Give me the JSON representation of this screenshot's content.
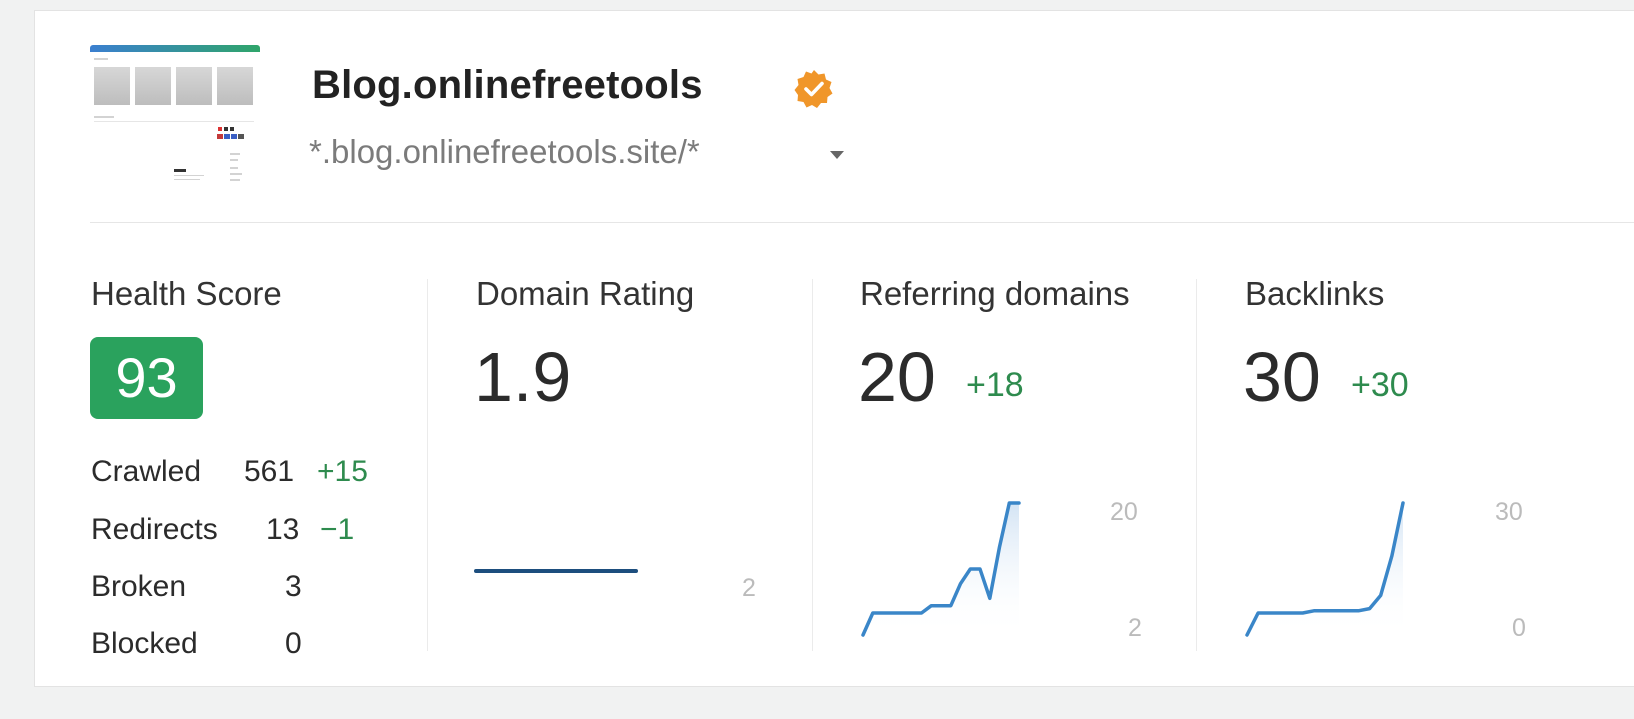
{
  "site": {
    "title": "Blog.onlinefreetools",
    "url": "*.blog.onlinefreetools.site/*",
    "verified_icon": "verified-badge-icon",
    "url_dropdown_icon": "caret-down-icon"
  },
  "colors": {
    "accent_green": "#2aa25d",
    "delta_green": "#2e8b4e",
    "spark_blue": "#3a86c8",
    "dr_line": "#1d4e7e",
    "badge_orange": "#f0962a"
  },
  "health": {
    "label": "Health Score",
    "score": "93",
    "stats": [
      {
        "label": "Crawled",
        "value": "561",
        "delta": "+15"
      },
      {
        "label": "Redirects",
        "value": "13",
        "delta": "−1"
      },
      {
        "label": "Broken",
        "value": "3",
        "delta": ""
      },
      {
        "label": "Blocked",
        "value": "0",
        "delta": ""
      }
    ]
  },
  "domain_rating": {
    "label": "Domain Rating",
    "value": "1.9",
    "axis_max": "2",
    "chart_data": {
      "type": "line",
      "values": [
        2,
        2,
        2,
        2,
        2,
        2
      ],
      "ylim": [
        0,
        4
      ]
    }
  },
  "referring_domains": {
    "label": "Referring domains",
    "value": "20",
    "delta": "+18",
    "axis_max": "20",
    "axis_min": "2",
    "chart_data": {
      "type": "area",
      "values": [
        2,
        5,
        5,
        5,
        5,
        5,
        5,
        6,
        6,
        6,
        9,
        11,
        11,
        7,
        14,
        20,
        20
      ],
      "ylim": [
        2,
        20
      ]
    }
  },
  "backlinks": {
    "label": "Backlinks",
    "value": "30",
    "delta": "+30",
    "axis_max": "30",
    "axis_min": "0",
    "chart_data": {
      "type": "area",
      "values": [
        0,
        5,
        5,
        5,
        5,
        5,
        5.5,
        5.5,
        5.5,
        5.5,
        5.5,
        6,
        9,
        18,
        30
      ],
      "ylim": [
        0,
        30
      ]
    }
  }
}
